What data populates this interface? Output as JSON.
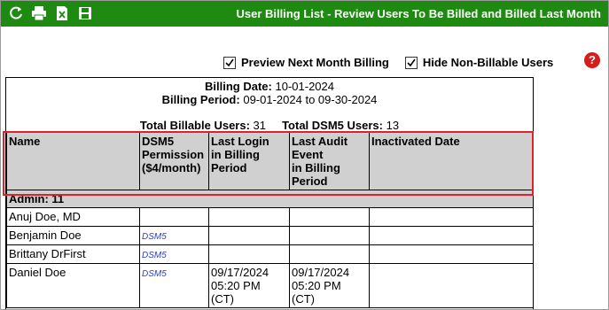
{
  "title": "User Billing List - Review Users To Be Billed and Billed Last Month",
  "toolbar": {
    "icons": [
      "refresh-icon",
      "print-icon",
      "excel-icon",
      "save-icon"
    ]
  },
  "options": {
    "preview_label": "Preview Next Month Billing",
    "preview_checked": true,
    "hide_label": "Hide Non-Billable Users",
    "hide_checked": true
  },
  "help": {
    "symbol": "?"
  },
  "report": {
    "billing_date_label": "Billing Date:",
    "billing_date": "10-01-2024",
    "billing_period_label": "Billing Period:",
    "billing_period": "09-01-2024 to 09-30-2024",
    "total_billable_label": "Total Billable Users:",
    "total_billable": "31",
    "total_dsm5_label": "Total DSM5 Users:",
    "total_dsm5": "13"
  },
  "table": {
    "columns": {
      "name": "Name",
      "dsm5_line1": "DSM5",
      "dsm5_line2": "Permission",
      "dsm5_line3": "($4/month)",
      "login_line1": "Last Login",
      "login_line2": "in Billing",
      "login_line3": "Period",
      "audit_line1": "Last Audit",
      "audit_line2": "Event",
      "audit_line3": "in Billing",
      "audit_line4": "Period",
      "inactivated": "Inactivated Date"
    },
    "group": "Admin: 11",
    "rows": [
      {
        "name": "Anuj Doe, MD",
        "dsm5": "",
        "login": "",
        "audit": "",
        "inactivated": ""
      },
      {
        "name": "Benjamin Doe",
        "dsm5": "DSM5",
        "login": "",
        "audit": "",
        "inactivated": ""
      },
      {
        "name": "Brittany DrFirst",
        "dsm5": "DSM5",
        "login": "",
        "audit": "",
        "inactivated": ""
      },
      {
        "name": "Daniel Doe",
        "dsm5": "DSM5",
        "login_date": "09/17/2024",
        "login_time": "05:20 PM",
        "login_tz": "(CT)",
        "audit_date": "09/17/2024",
        "audit_time": "05:20 PM",
        "audit_tz": "(CT)",
        "inactivated": ""
      }
    ]
  },
  "colors": {
    "titlebar": "#1e8a12",
    "header_bg": "#d0d0d0",
    "highlight": "#e0202a",
    "dsm_link": "#2a3fc8"
  }
}
